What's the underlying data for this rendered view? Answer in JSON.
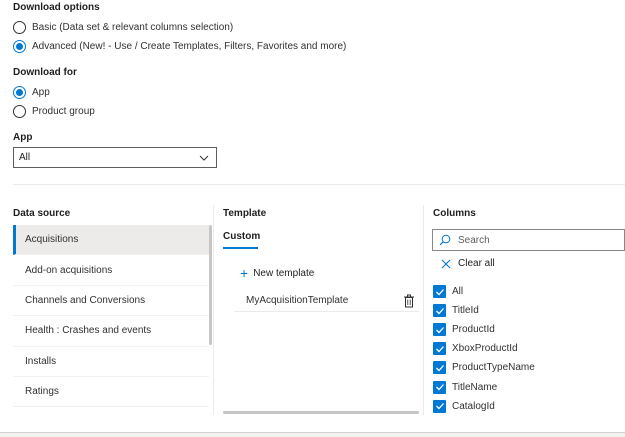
{
  "download_options": {
    "label": "Download options",
    "options": [
      {
        "label": "Basic (Data set & relevant columns selection)",
        "checked": false
      },
      {
        "label": "Advanced (New! - Use / Create Templates, Filters, Favorites and more)",
        "checked": true
      }
    ]
  },
  "download_for": {
    "label": "Download for",
    "options": [
      {
        "label": "App",
        "checked": true
      },
      {
        "label": "Product group",
        "checked": false
      }
    ]
  },
  "app": {
    "label": "App",
    "selected": "All"
  },
  "data_source": {
    "label": "Data source",
    "items": [
      "Acquisitions",
      "Add-on acquisitions",
      "Channels and Conversions",
      "Health : Crashes and events",
      "Installs",
      "Ratings"
    ],
    "selected_index": 0
  },
  "template": {
    "label": "Template",
    "tab": "Custom",
    "new_label": "New template",
    "items": [
      "MyAcquisitionTemplate"
    ]
  },
  "columns": {
    "label": "Columns",
    "search_placeholder": "Search",
    "clear_label": "Clear all",
    "items": [
      "All",
      "TitleId",
      "ProductId",
      "XboxProductId",
      "ProductTypeName",
      "TitleName",
      "CatalogId"
    ]
  },
  "colors": {
    "accent": "#0078d4"
  }
}
